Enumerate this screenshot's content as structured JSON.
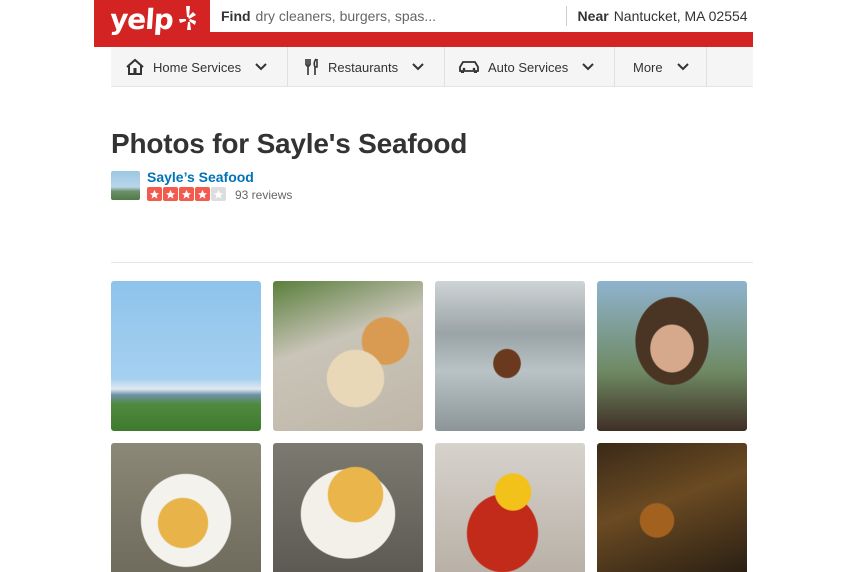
{
  "header": {
    "logo_text": "yelp",
    "find_label": "Find",
    "find_placeholder": "dry cleaners, burgers, spas...",
    "near_label": "Near",
    "near_value": "Nantucket, MA 02554",
    "brand_color": "#d32323"
  },
  "categories": [
    {
      "label": "Home Services",
      "icon": "house-icon"
    },
    {
      "label": "Restaurants",
      "icon": "fork-knife-icon"
    },
    {
      "label": "Auto Services",
      "icon": "car-icon"
    },
    {
      "label": "More",
      "icon": ""
    }
  ],
  "page": {
    "title": "Photos for Sayle's Seafood",
    "business_name": "Sayle’s Seafood",
    "rating": 4,
    "rating_max": 5,
    "reviews": "93 reviews",
    "star_color": "#f15c4f",
    "link_color": "#0073bb"
  },
  "photos": [
    {
      "subject": "harbor view"
    },
    {
      "subject": "fried fish sandwich platter"
    },
    {
      "subject": "live lobster held up"
    },
    {
      "subject": "woman eating lobster"
    },
    {
      "subject": "fried seafood plate with fries"
    },
    {
      "subject": "fried clams with fries"
    },
    {
      "subject": "lobster bake with corn"
    },
    {
      "subject": "lobsters in tank"
    }
  ]
}
